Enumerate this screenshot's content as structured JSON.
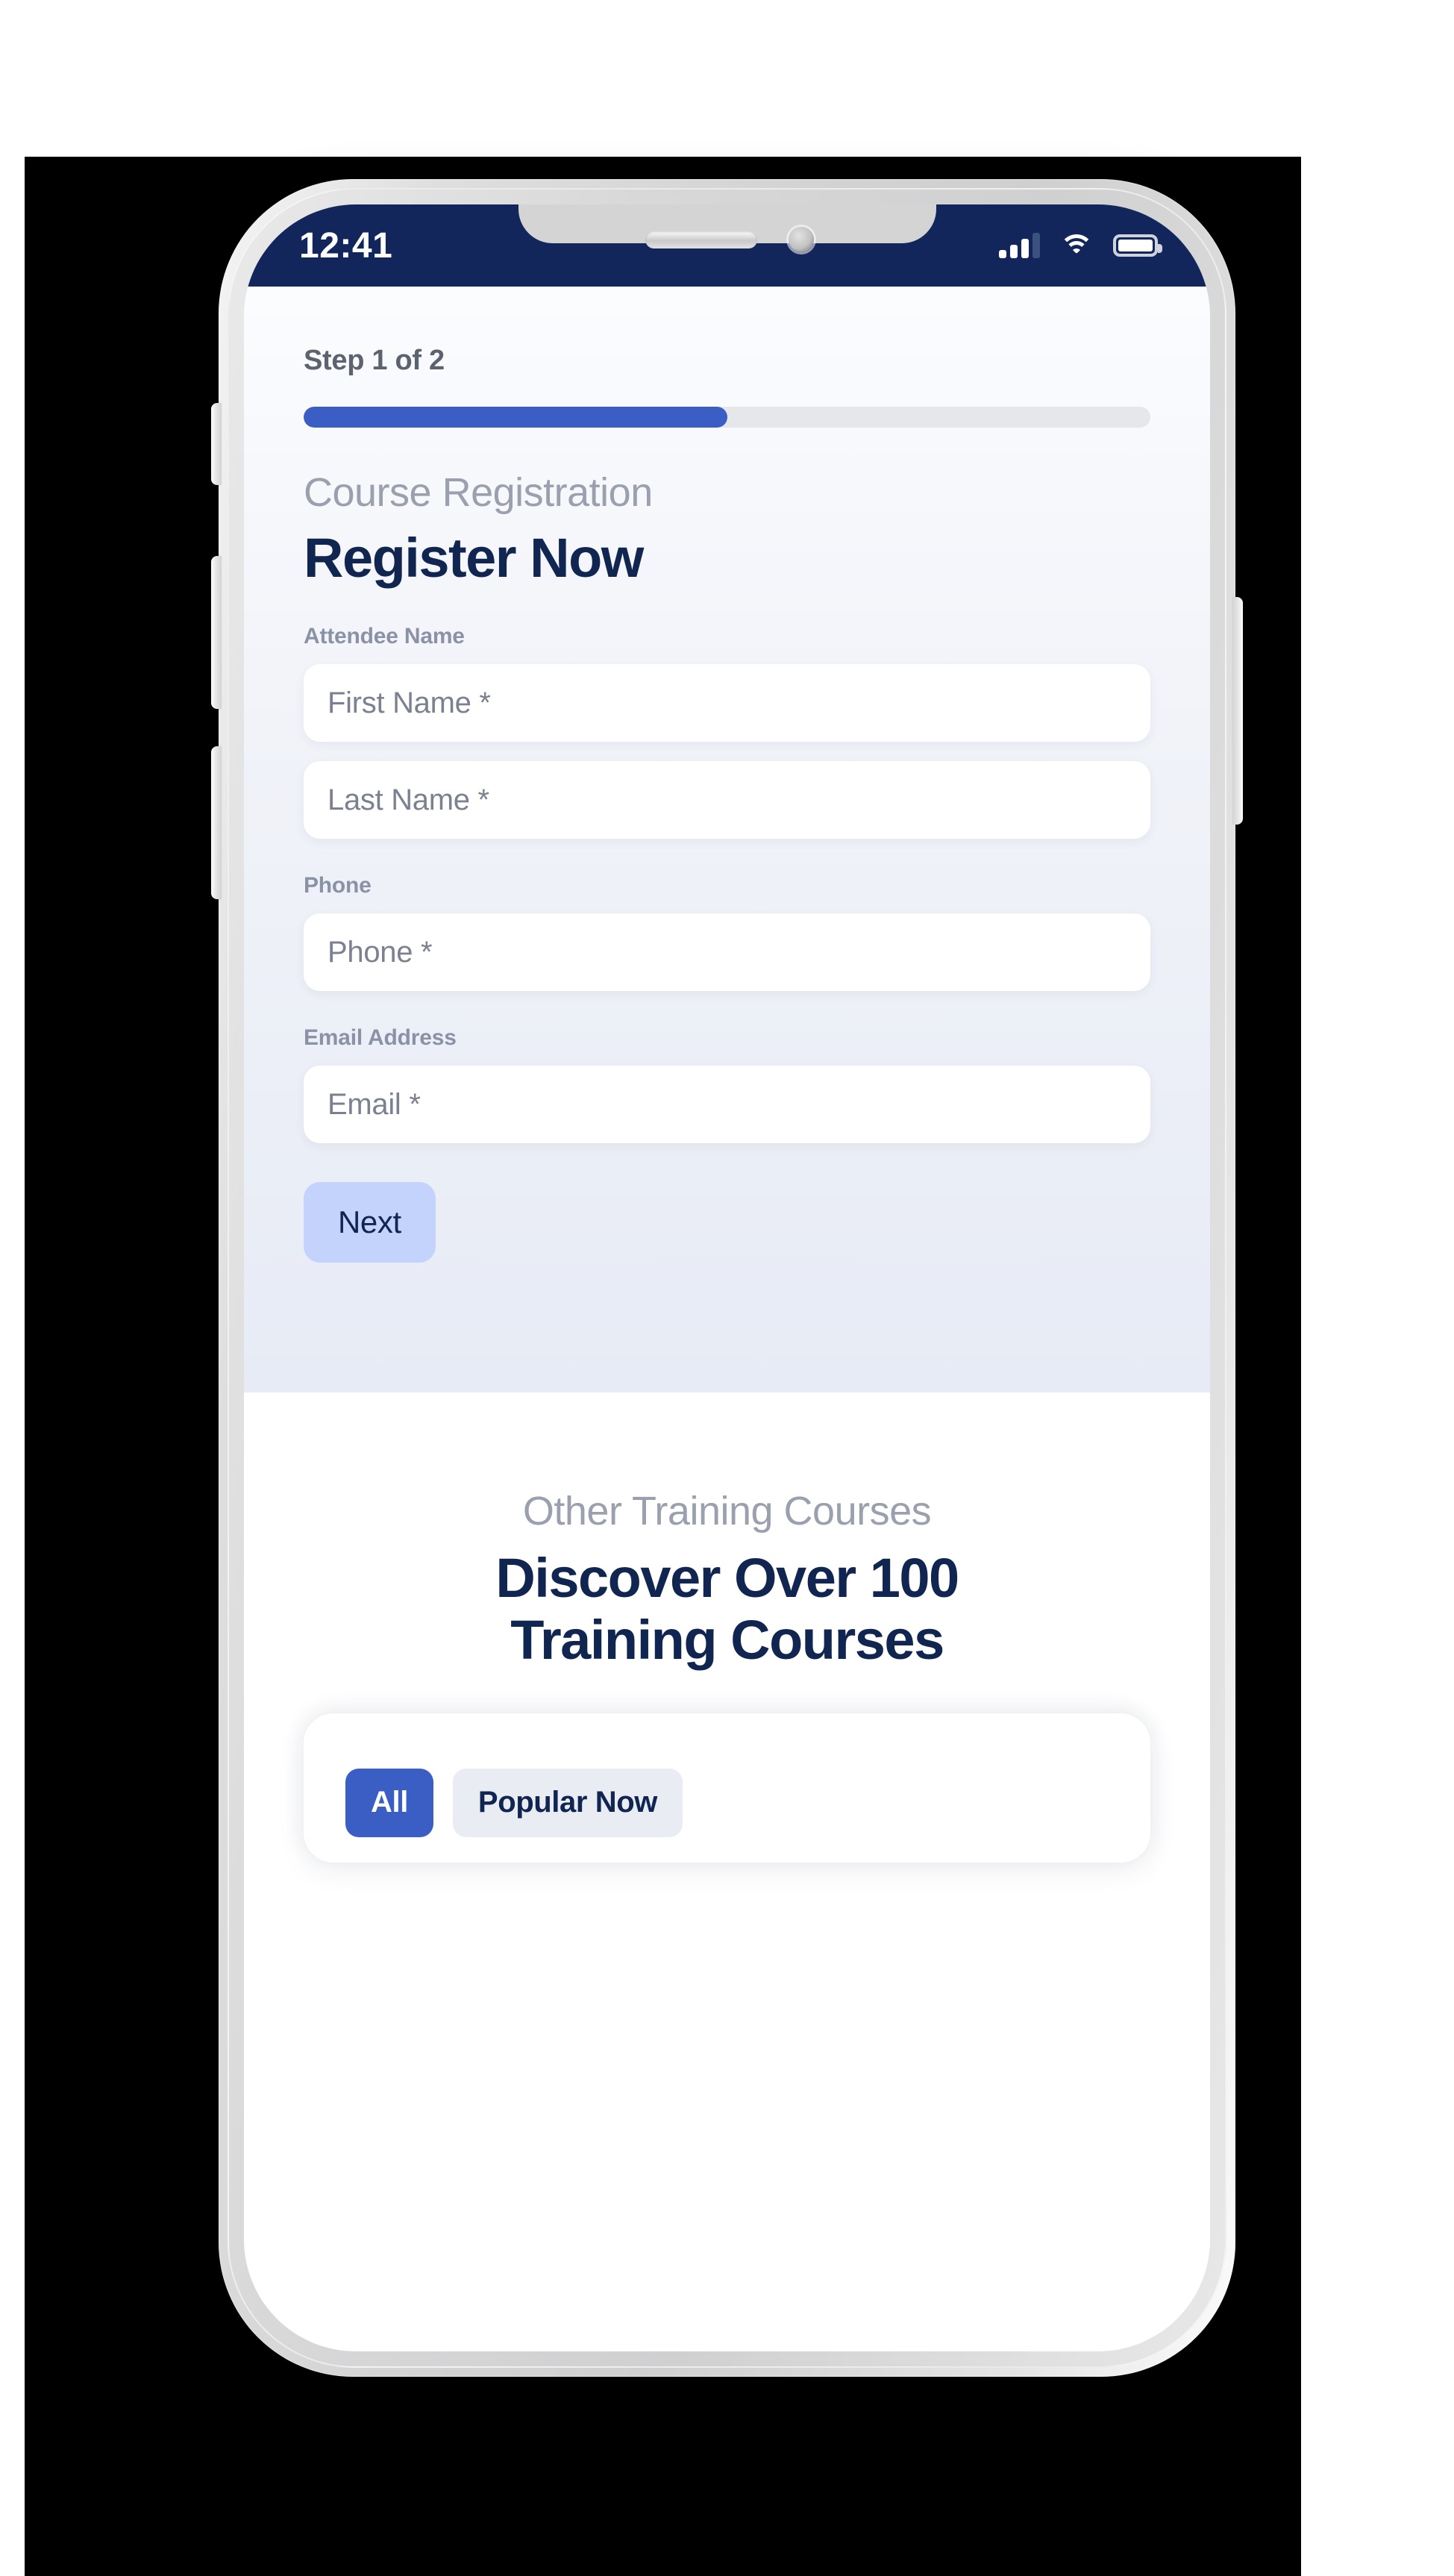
{
  "status_bar": {
    "time": "12:41",
    "signal_icon": "cellular-signal-icon",
    "wifi_icon": "wifi-icon",
    "battery_icon": "battery-full-icon"
  },
  "form": {
    "step_label": "Step 1 of 2",
    "progress_percent": 50,
    "eyebrow": "Course Registration",
    "headline": "Register Now",
    "groups": [
      {
        "label": "Attendee Name",
        "fields": [
          {
            "placeholder": "First Name *",
            "value": ""
          },
          {
            "placeholder": "Last Name *",
            "value": ""
          }
        ]
      },
      {
        "label": "Phone",
        "fields": [
          {
            "placeholder": "Phone *",
            "value": ""
          }
        ]
      },
      {
        "label": "Email Address",
        "fields": [
          {
            "placeholder": "Email *",
            "value": ""
          }
        ]
      }
    ],
    "next_label": "Next"
  },
  "courses": {
    "eyebrow": "Other Training Courses",
    "headline_line1": "Discover Over 100",
    "headline_line2": "Training Courses",
    "tabs": [
      {
        "label": "All",
        "active": true
      },
      {
        "label": "Popular Now",
        "active": false
      }
    ]
  },
  "colors": {
    "brand_navy": "#12265c",
    "accent_blue": "#3b5ec4",
    "accent_blue_soft": "#c3d3fb",
    "heading_navy": "#10254f",
    "muted_gray": "#9aa0ae",
    "label_gray": "#8b92a6",
    "placeholder_gray": "#7b8190",
    "track_gray": "#e5e7eb",
    "tab_inactive_bg": "#e9ecf3"
  }
}
